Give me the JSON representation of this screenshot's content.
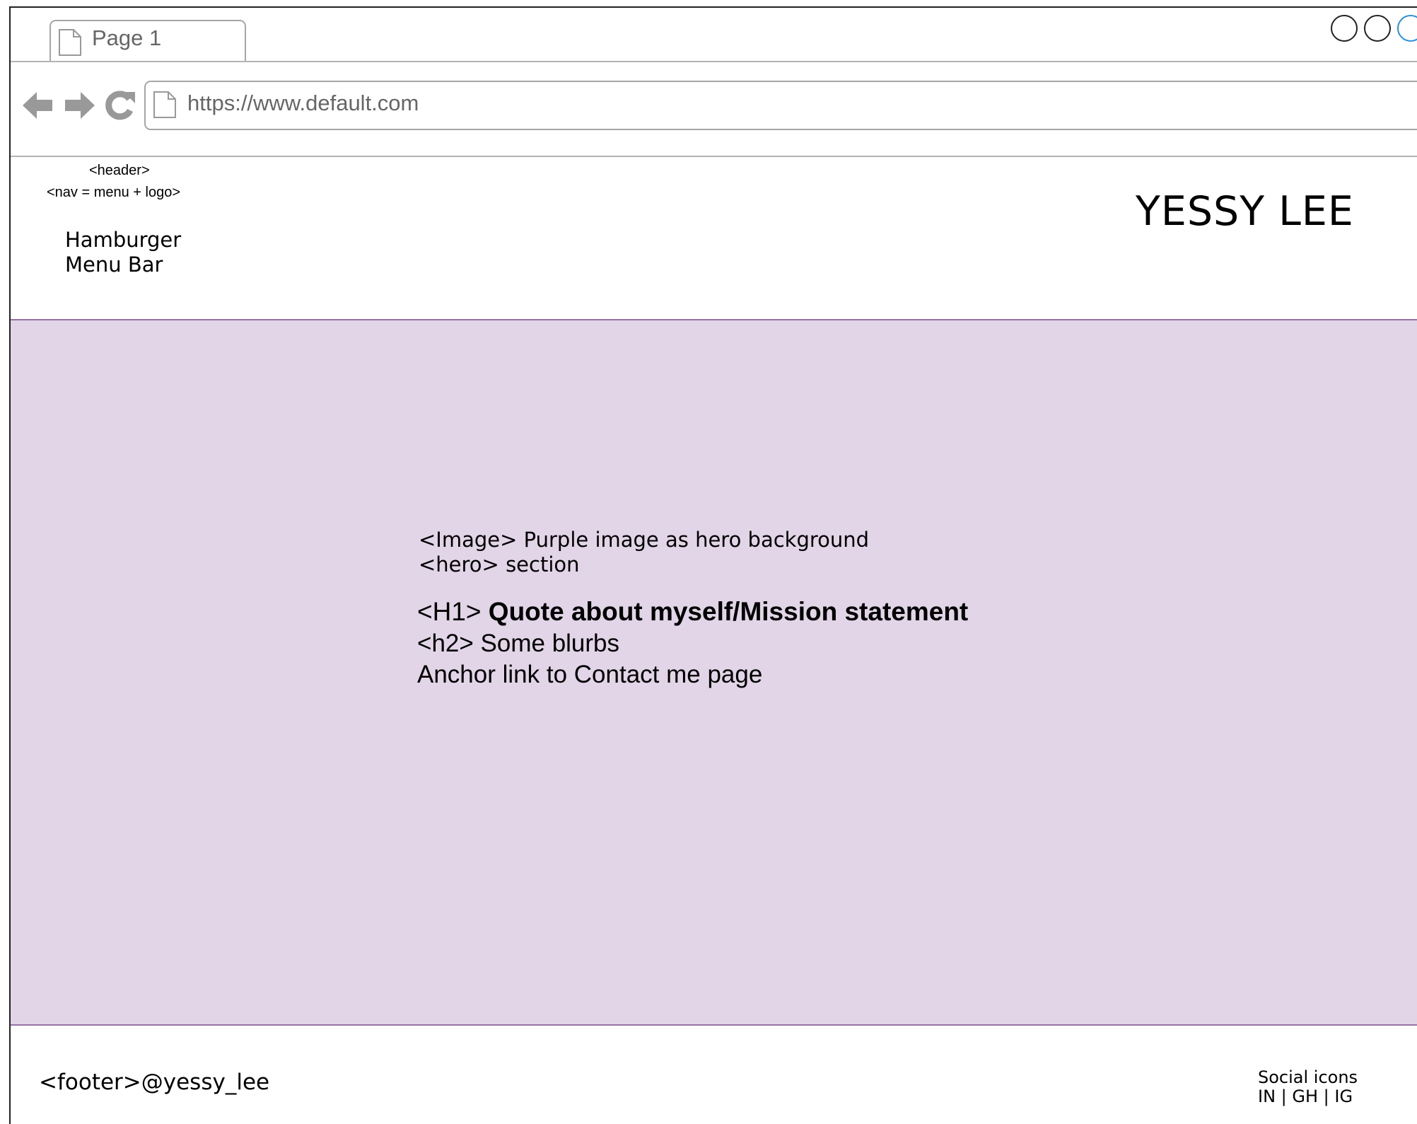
{
  "browser": {
    "tab_label": "Page 1",
    "url": "https://www.default.com"
  },
  "header": {
    "note_line1": "<header>",
    "note_line2": "<nav = menu + logo>",
    "menu_line1": "Hamburger",
    "menu_line2": "Menu Bar",
    "logo_text": "YESSY LEE"
  },
  "hero": {
    "note_line1": "<Image> Purple image as hero background",
    "note_line2": "<hero> section",
    "h1_prefix": "<H1> ",
    "h1_text": "Quote about myself/Mission statement",
    "h2_text": "<h2> Some blurbs",
    "link_text": "Anchor link to Contact me page",
    "background_color": "#e1d5e7"
  },
  "footer": {
    "text": "<footer>@yessy_lee",
    "social_label": "Social icons",
    "social_links": "IN | GH | IG"
  }
}
